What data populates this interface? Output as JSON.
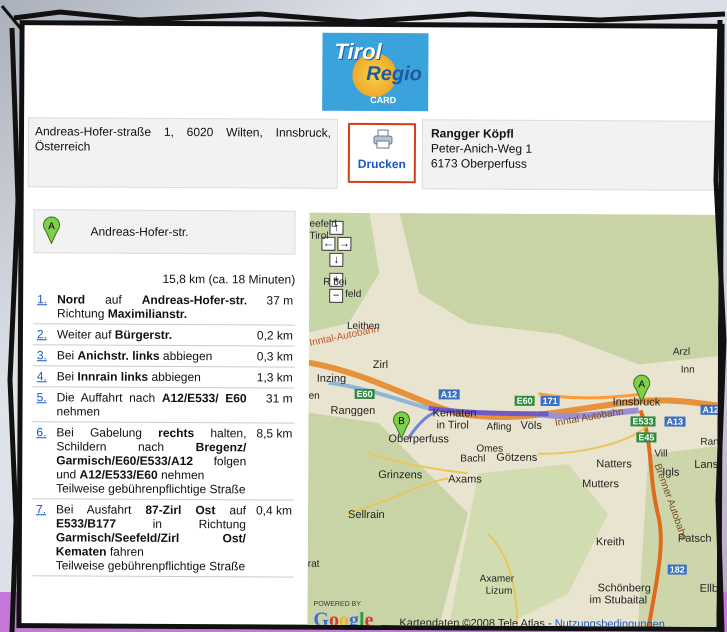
{
  "logo": {
    "line1": "Tirol",
    "line2": "Regio",
    "line3": "CARD"
  },
  "from_address": "Andreas-Hofer-straße 1, 6020 Wilten, Innsbruck, Österreich",
  "print_button": {
    "label": "Drucken",
    "icon": "printer-icon"
  },
  "to_address": {
    "name": "Rangger Köpfl",
    "street": "Peter-Anich-Weg 1",
    "city": "6173 Oberperfuss"
  },
  "start": {
    "marker": "A",
    "label": "Andreas-Hofer-str."
  },
  "summary": "15,8 km (ca. 18 Minuten)",
  "steps": [
    {
      "num": "1.",
      "html": "<b>Nord</b> auf <b>Andreas-Hofer-str.</b> Richtung <b>Maximilianstr.</b>",
      "dist": "37 m"
    },
    {
      "num": "2.",
      "html": "Weiter auf <b>Bürgerstr.</b>",
      "dist": "0,2 km"
    },
    {
      "num": "3.",
      "html": "Bei <b>Anichstr.</b> <b>links</b> abbiegen",
      "dist": "0,3 km"
    },
    {
      "num": "4.",
      "html": "Bei <b>Innrain</b> <b>links</b> abbiegen",
      "dist": "1,3 km"
    },
    {
      "num": "5.",
      "html": "Die Auffahrt nach <b>A12/E533/ E60</b> nehmen",
      "dist": "31 m"
    },
    {
      "num": "6.",
      "html": "Bei Gabelung <b>rechts</b> halten, Schildern nach <b>Bregenz/ Garmisch/E60/E533/A12</b> folgen und <b>A12/E533/E60</b> nehmen<br>Teilweise gebührenpflichtige Straße",
      "dist": "8,5 km"
    },
    {
      "num": "7.",
      "html": "Bei Ausfahrt <b>87-Zirl Ost</b> auf <b>E533/B177</b> in Richtung <b>Garmisch/Seefeld/Zirl Ost/ Kematen</b> fahren<br>Teilweise gebührenpflichtige Straße",
      "dist": "0,4 km"
    }
  ],
  "map": {
    "labels": {
      "seefeld": "eefeld",
      "tirol": "Tirol",
      "rbei": "R   bei",
      "feld": "feld",
      "leithen": "Leithen",
      "zirl": "Zirl",
      "inzing": "Inzing",
      "ranggen": "Ranggen",
      "kematen": "Kematen",
      "intirol": "in Tirol",
      "afling": "Afling",
      "vols": "Völs",
      "innsbruck": "Innsbruck",
      "arzl": "Arzl",
      "inn": "Inn",
      "oberperfuss": "Oberperfuss",
      "bachl": "Bachl",
      "omes": "Omes",
      "gotzens": "Götzens",
      "grinzens": "Grinzens",
      "axams": "Axams",
      "natters": "Natters",
      "mutters": "Mutters",
      "igls": "Igls",
      "lans": "Lans",
      "vill": "Vill",
      "rans": "Rans",
      "sellrain": "Sellrain",
      "kreith": "Kreith",
      "axamer": "Axamer",
      "lizum": "Lizum",
      "patsch": "Patsch",
      "schonberg": "Schönberg",
      "stubaital": "im Stubaital",
      "ellb": "Ellb",
      "autobahn1": "Inntal-Autobahn",
      "autobahn2": "Inntal Autobahn",
      "brenner": "Brenner Autobahn",
      "en": "en",
      "rat": "rat"
    },
    "shields": {
      "e60a": "E60",
      "e60b": "E60",
      "a12a": "A12",
      "a12b": "A12",
      "a13": "A13",
      "e533": "E533",
      "e45": "E45",
      "n171": "171",
      "n182": "182"
    },
    "markers": {
      "a": "A",
      "b": "B"
    },
    "controls": {
      "up": "↑",
      "left": "←",
      "right": "→",
      "down": "↓",
      "zoomin": "+",
      "zoomout": "−"
    },
    "powered_by": "POWERED BY",
    "google": "Google",
    "copyright": "Kartendaten ©2008 Tele Atlas - ",
    "terms_link": "Nutzungsbedingungen"
  }
}
